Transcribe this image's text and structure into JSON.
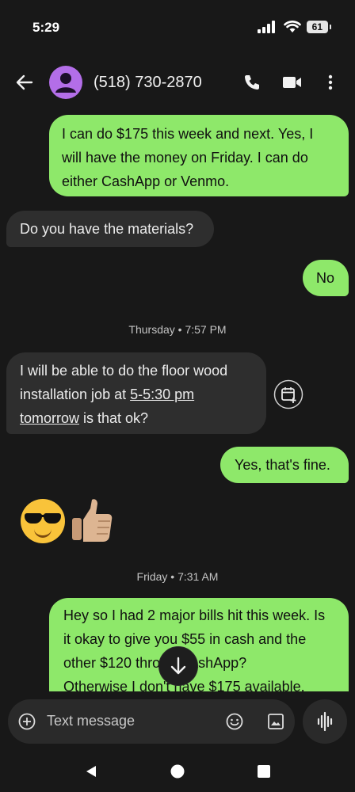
{
  "status": {
    "time": "5:29",
    "battery": "61"
  },
  "header": {
    "contact": "(518) 730-2870"
  },
  "messages": {
    "m1": [
      "I can do $175 this week and next. Yes, I",
      "will have the money on Friday. I can do",
      "either CashApp or Venmo."
    ],
    "m2": "Do you have the materials?",
    "m3": "No",
    "ts1": "Thursday • 7:57 PM",
    "m4": {
      "line1": "I will be able to do the floor wood",
      "line2_pre": "installation job at ",
      "line2_link": "5-5:30 pm",
      "line3_link": "tomorrow",
      "line3_post": " is that ok?"
    },
    "m5": "Yes, that's fine.",
    "m6": "😎👍",
    "ts2": "Friday • 7:31 AM",
    "m7": [
      "Hey so I had 2 major bills hit this week. Is",
      "it okay to give you $55 in cash and the",
      "other $120 thro     CashApp?",
      "Otherwise I don't have $175 available."
    ]
  },
  "compose": {
    "placeholder": "Text message"
  },
  "icons": {
    "back": "arrow-left-icon",
    "call": "phone-icon",
    "video": "video-camera-icon",
    "more": "more-vert-icon",
    "calendar": "calendar-add-icon",
    "scroll": "arrow-down-icon",
    "add": "add-circle-icon",
    "emoji": "emoji-icon",
    "gallery": "image-icon",
    "voice": "voice-waveform-icon"
  },
  "colors": {
    "outgoing": "#8ee86a",
    "incoming": "#2e2e2e",
    "background": "#181818",
    "avatar": "#b36ee8"
  }
}
